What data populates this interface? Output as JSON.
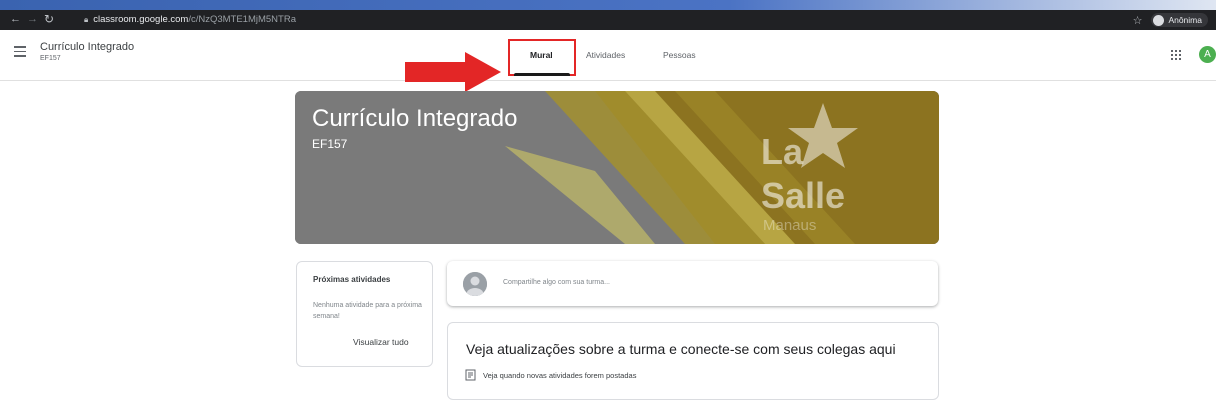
{
  "browser": {
    "url_host": "classroom.google.com",
    "url_path": "/c/NzQ3MTE1MjM5NTRa",
    "profile_label": "Anônima"
  },
  "header": {
    "class_name": "Currículo Integrado",
    "class_code": "EF157",
    "tabs": [
      {
        "label": "Mural",
        "active": true
      },
      {
        "label": "Atividades",
        "active": false
      },
      {
        "label": "Pessoas",
        "active": false
      }
    ],
    "account_initial": "A"
  },
  "banner": {
    "title": "Currículo Integrado",
    "code": "EF157",
    "logo_line1": "La",
    "logo_line2": "Salle",
    "logo_line3": "Manaus"
  },
  "upcoming": {
    "title": "Próximas atividades",
    "empty_text": "Nenhuma atividade para a próxima semana!",
    "view_all": "Visualizar tudo"
  },
  "stream": {
    "share_placeholder": "Compartilhe algo com sua turma...",
    "updates_headline": "Veja atualizações sobre a turma e conecte-se com seus colegas aqui",
    "updates_note": "Veja quando novas atividades forem postadas"
  },
  "colors": {
    "highlight": "#e32626",
    "banner_gold": "#8c7320",
    "banner_gray": "#7a7a7a"
  }
}
